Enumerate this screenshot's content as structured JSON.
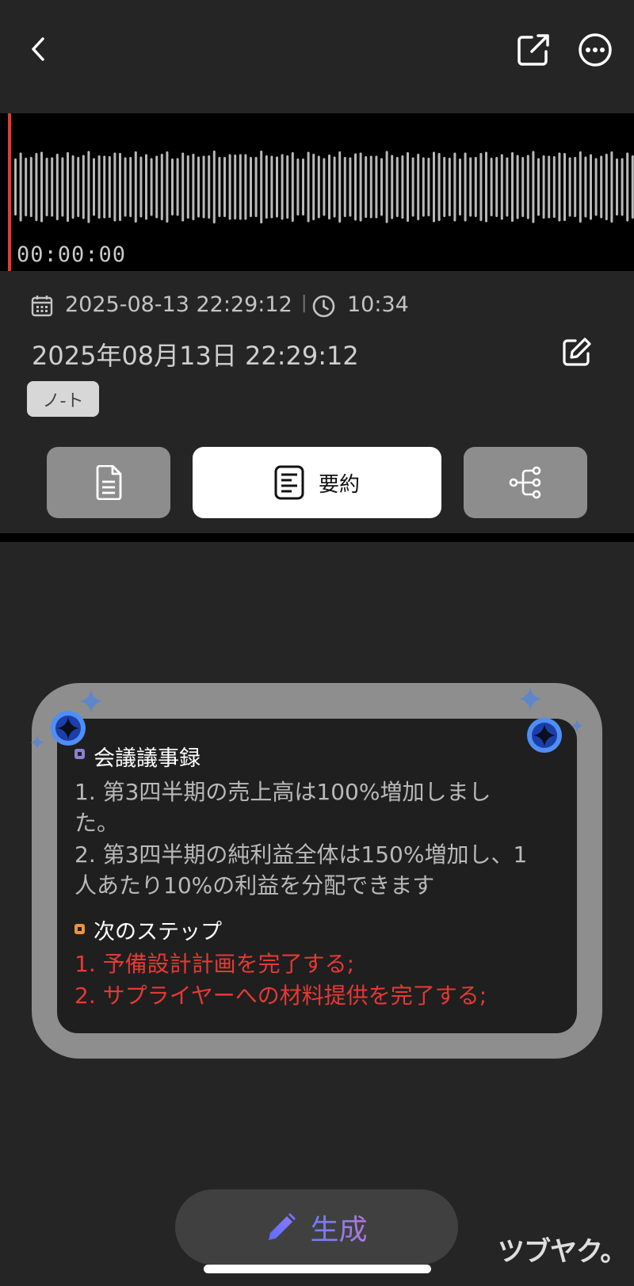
{
  "header": {
    "back_icon": "chevron-left-icon",
    "share_icon": "share-external-icon",
    "more_icon": "more-horizontal-icon"
  },
  "player": {
    "timecode": "00:00:00",
    "accent": "#e53935"
  },
  "meta": {
    "datetime": "2025-08-13 22:29:12",
    "separator": "|",
    "duration": "10:34",
    "title": "2025年08月13日 22:29:12",
    "tag": "ノ-ト"
  },
  "tabs": [
    {
      "icon": "document-icon",
      "label": ""
    },
    {
      "icon": "summary-icon",
      "label": "要約"
    },
    {
      "icon": "mindmap-icon",
      "label": ""
    }
  ],
  "summary": {
    "minutes_heading": "会議議事録",
    "minutes_lines": [
      "1. 第3四半期の売上高は100%増加しまし",
      "た。",
      "2. 第3四半期の純利益全体は150%増加し、1",
      "人あたり10%の利益を分配できます"
    ],
    "next_heading": "次のステップ",
    "next_lines": [
      "1. 予備設計計画を完了する;",
      "2. サプライヤーへの材料提供を完了する;"
    ],
    "bullet_colors": {
      "minutes": "#8b7fd6",
      "next": "#f0923a"
    }
  },
  "generate": {
    "label": "生成",
    "icon": "pencil-icon"
  },
  "watermark": "ツブヤク。"
}
